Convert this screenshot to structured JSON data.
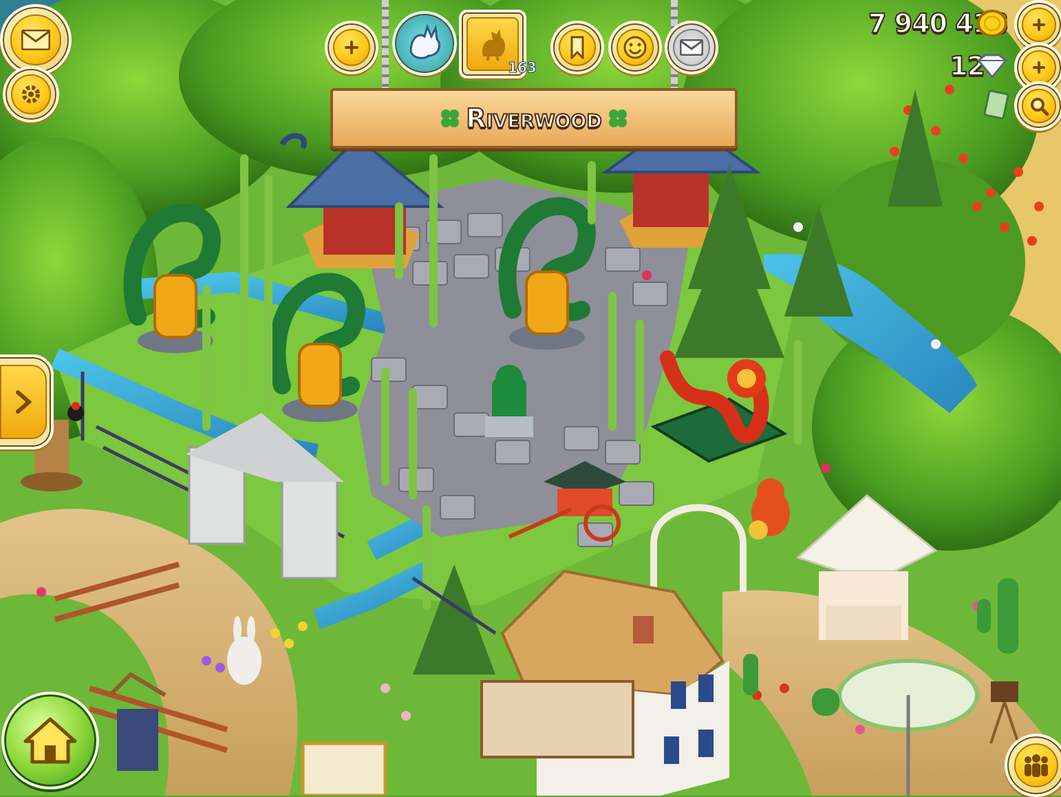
{
  "hud": {
    "coins": "7 940 418",
    "diamonds": "12",
    "level": "163",
    "farm_name": "Riverwood"
  },
  "icons": {
    "mail": "envelope-icon",
    "settings": "gear-icon",
    "add": "plus-icon",
    "pet": "fox-pet-icon",
    "rooster": "rooster-icon",
    "bookmark": "bookmark-icon",
    "smile": "smiley-icon",
    "message": "letter-icon",
    "coin": "gold-coin-icon",
    "diamond": "diamond-icon",
    "cash": "cash-icon",
    "search": "magnifier-icon",
    "expand": "arrow-right-icon",
    "home": "home-icon",
    "friends": "friends-icon"
  },
  "colors": {
    "button_gold": "#ffc718",
    "button_frame": "#f6e7a4",
    "banner_wood": "#e9a85a",
    "grass": "#5aa82c",
    "water": "#3aa6d2"
  }
}
